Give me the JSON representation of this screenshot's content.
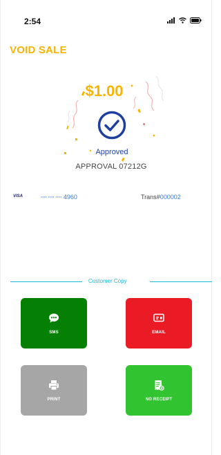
{
  "status_bar": {
    "time": "2:54"
  },
  "screen": {
    "title": "VOID SALE"
  },
  "transaction": {
    "amount": "$1.00",
    "status": "Approved",
    "approval": "APPROVAL 07212G",
    "card_brand": "VISA",
    "card_mask": "**** **** ****",
    "card_last4": "4960",
    "trans_label": "Trans#",
    "trans_number": "000002"
  },
  "receipt_section": {
    "label": "Customer Copy"
  },
  "actions": {
    "sms": {
      "label": "SMS"
    },
    "email": {
      "label": "EMAIL"
    },
    "print": {
      "label": "PRINT"
    },
    "no_receipt": {
      "label": "NO RECEIPT"
    }
  },
  "icons": {
    "status": [
      "signal-icon",
      "wifi-icon",
      "battery-icon"
    ],
    "success": "checkmark-circle-icon",
    "sms": "chat-bubble-icon",
    "email": "card-reader-icon",
    "print": "printer-icon",
    "no_receipt": "receipt-cancel-icon"
  },
  "colors": {
    "accent_yellow": "#f7b500",
    "approved_blue": "#1f3fa0",
    "link_blue": "#3b7dd8",
    "divider_cyan": "#19b7d9",
    "sms_green": "#058005",
    "email_red": "#eb1b25",
    "print_gray": "#a6a6a6",
    "no_receipt_green": "#32c430"
  }
}
